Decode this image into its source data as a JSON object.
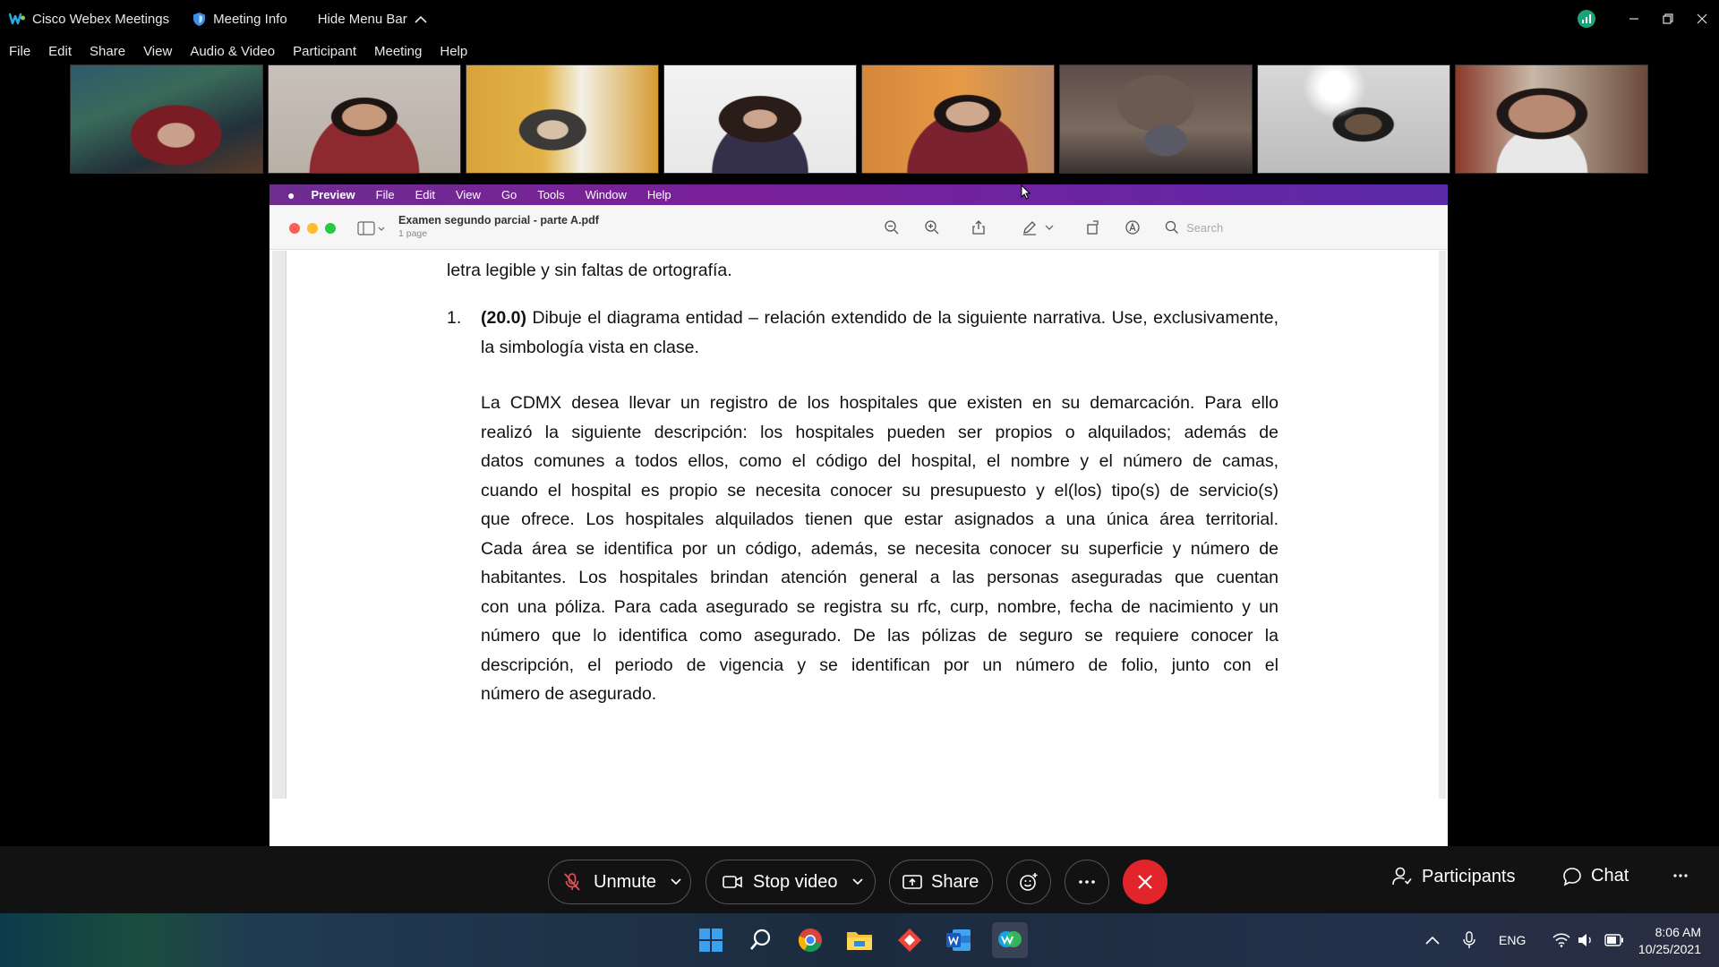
{
  "window": {
    "app_title": "Cisco Webex Meetings",
    "meeting_info": "Meeting Info",
    "hide_menu_bar": "Hide Menu Bar"
  },
  "menu": [
    "File",
    "Edit",
    "Share",
    "View",
    "Audio & Video",
    "Participant",
    "Meeting",
    "Help"
  ],
  "participants_count_thumbs": 8,
  "preview": {
    "mac_menu": [
      "Preview",
      "File",
      "Edit",
      "View",
      "Go",
      "Tools",
      "Window",
      "Help"
    ],
    "doc_title": "Examen segundo parcial - parte  A.pdf",
    "doc_pages": "1 page",
    "search_placeholder": "Search",
    "lead_line": "letra legible y sin faltas de ortografía.",
    "item_number": "1.",
    "item_points": "(20.0)",
    "item_text": " Dibuje el diagrama entidad – relación extendido de la siguiente narrativa. Use, exclusivamente, la simbología vista en clase.",
    "paragraph_lines": [
      "La CDMX desea llevar un registro de los hospitales que existen en su demarcación. Para ello",
      "realizó la siguiente descripción: los hospitales pueden ser propios o alquilados; además de",
      "datos comunes a todos ellos, como el código del hospital, el nombre y el número de camas,",
      "cuando el hospital es propio se necesita conocer su presupuesto y el(los) tipo(s) de servicio(s)",
      "que ofrece. Los hospitales alquilados tienen que estar asignados a una única área territorial.",
      "Cada área se identifica por un código, además, se necesita conocer su superficie y número de",
      "habitantes. Los hospitales brindan atención general a las personas aseguradas que cuentan",
      "con una póliza. Para cada asegurado se registra su rfc, curp, nombre, fecha de nacimiento y un",
      "número que lo identifica como asegurado. De las pólizas de seguro se requiere conocer la",
      "descripción, el periodo de vigencia y se identifican por un número de folio, junto con el",
      "número de asegurado."
    ]
  },
  "controls": {
    "unmute": "Unmute",
    "stop_video": "Stop video",
    "share": "Share",
    "participants": "Participants",
    "chat": "Chat"
  },
  "taskbar": {
    "language": "ENG",
    "time": "8:06 AM",
    "date": "10/25/2021"
  },
  "colors": {
    "mac_menu_accent": "#6e2d8f",
    "end_call": "#e1252b",
    "webex_status": "#1aa37a"
  }
}
